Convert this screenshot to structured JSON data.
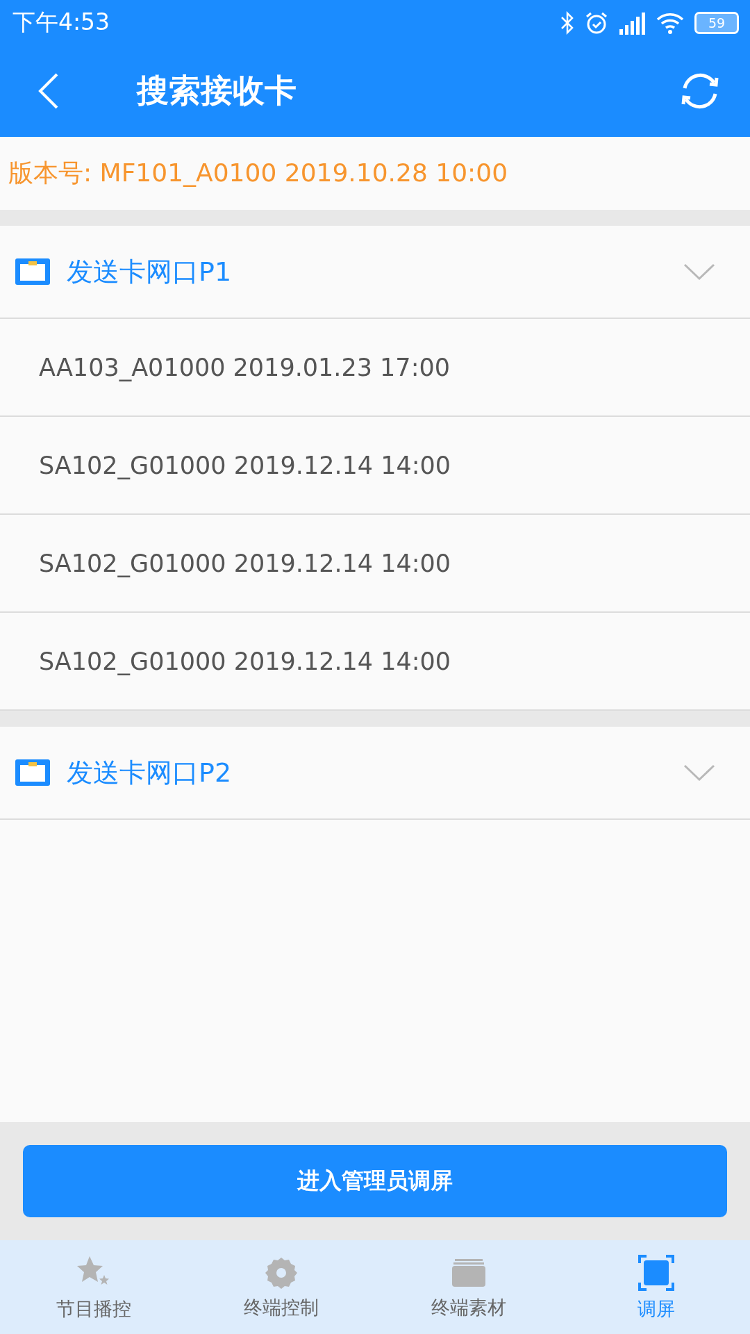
{
  "status_bar": {
    "time": "下午4:53",
    "battery": "59"
  },
  "app_bar": {
    "title": "搜索接收卡"
  },
  "version": {
    "label": "版本号: MF101_A0100 2019.10.28 10:00"
  },
  "groups": [
    {
      "title": "发送卡网口P1",
      "items": [
        {
          "text": "AA103_A01000 2019.01.23 17:00"
        },
        {
          "text": "SA102_G01000 2019.12.14 14:00"
        },
        {
          "text": "SA102_G01000 2019.12.14 14:00"
        },
        {
          "text": "SA102_G01000 2019.12.14 14:00"
        }
      ]
    },
    {
      "title": "发送卡网口P2"
    }
  ],
  "admin_button": {
    "label": "进入管理员调屏"
  },
  "nav": [
    {
      "label": "节目播控",
      "kind": "stars",
      "selected": false
    },
    {
      "label": "终端控制",
      "kind": "gear",
      "selected": false
    },
    {
      "label": "终端素材",
      "kind": "stack",
      "selected": false
    },
    {
      "label": "调屏",
      "kind": "screen",
      "selected": true
    }
  ]
}
